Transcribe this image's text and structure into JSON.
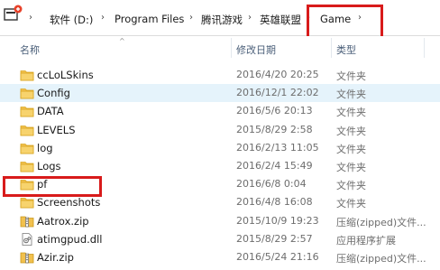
{
  "breadcrumb": [
    "软件 (D:)",
    "Program Files",
    "腾讯游戏",
    "英雄联盟",
    "Game"
  ],
  "columns": {
    "name": "名称",
    "date": "修改日期",
    "type": "类型"
  },
  "files": [
    {
      "name": "ccLoLSkins",
      "date": "2016/4/20 20:25",
      "type": "文件夹",
      "kind": "folder"
    },
    {
      "name": "Config",
      "date": "2016/12/1 22:02",
      "type": "文件夹",
      "kind": "folder"
    },
    {
      "name": "DATA",
      "date": "2016/5/6 20:13",
      "type": "文件夹",
      "kind": "folder"
    },
    {
      "name": "LEVELS",
      "date": "2015/8/29 2:58",
      "type": "文件夹",
      "kind": "folder"
    },
    {
      "name": "log",
      "date": "2016/2/13 11:05",
      "type": "文件夹",
      "kind": "folder"
    },
    {
      "name": "Logs",
      "date": "2016/2/4 15:49",
      "type": "文件夹",
      "kind": "folder"
    },
    {
      "name": "pf",
      "date": "2016/6/8 0:04",
      "type": "文件夹",
      "kind": "folder"
    },
    {
      "name": "Screenshots",
      "date": "2016/4/8 16:08",
      "type": "文件夹",
      "kind": "folder"
    },
    {
      "name": "Aatrox.zip",
      "date": "2015/10/9 19:23",
      "type": "压缩(zipped)文件...",
      "kind": "zip"
    },
    {
      "name": "atimgpud.dll",
      "date": "2015/8/29 2:57",
      "type": "应用程序扩展",
      "kind": "dll"
    },
    {
      "name": "Azir.zip",
      "date": "2016/5/24 21:16",
      "type": "压缩(zipped)文件...",
      "kind": "zip"
    }
  ],
  "selected_row": "Config",
  "highlighted": [
    "Game",
    "pf"
  ],
  "colors": {
    "folder": "#f2c14e",
    "selection": "#e5f3fb",
    "highlight_box": "#d81b1b"
  }
}
